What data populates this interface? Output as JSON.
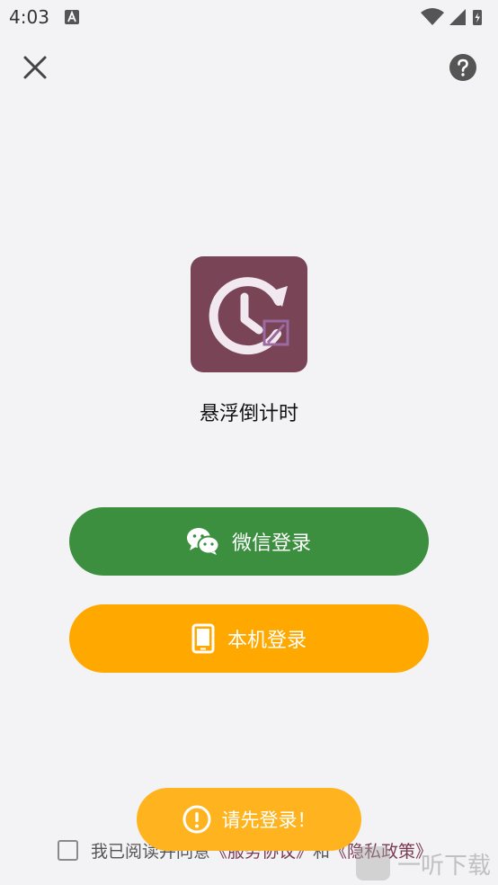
{
  "status_bar": {
    "time": "4:03"
  },
  "app": {
    "name": "悬浮倒计时",
    "icon_color": "#784456"
  },
  "buttons": {
    "wechat_label": "微信登录",
    "local_label": "本机登录"
  },
  "agreement": {
    "prefix": "我已阅读并同意",
    "service_link": "《服务协议》",
    "conjunction": "和",
    "privacy_link": "《隐私政策》"
  },
  "toast": {
    "message": "请先登录！"
  },
  "watermark": {
    "text": "一听下载"
  },
  "colors": {
    "wechat_green": "#3b8f3f",
    "local_orange": "#ffa900",
    "toast_orange": "#ffb41f",
    "link": "#7a3a50"
  }
}
